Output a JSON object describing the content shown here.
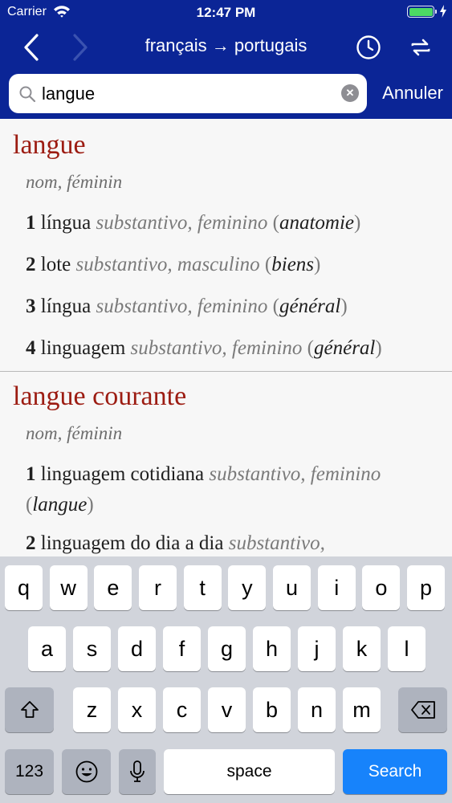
{
  "status": {
    "carrier": "Carrier",
    "time": "12:47 PM"
  },
  "nav": {
    "title": "français → portugais"
  },
  "search": {
    "value": "langue",
    "cancel_label": "Annuler"
  },
  "entries": [
    {
      "headword": "langue",
      "pos": "nom, féminin",
      "senses": [
        {
          "num": "1",
          "term": "língua",
          "gram": "substantivo, feminino",
          "context": "anatomie"
        },
        {
          "num": "2",
          "term": "lote",
          "gram": "substantivo, masculino",
          "context": "biens"
        },
        {
          "num": "3",
          "term": "língua",
          "gram": "substantivo, feminino",
          "context": "général"
        },
        {
          "num": "4",
          "term": "linguagem",
          "gram": "substantivo, feminino",
          "context": "général"
        }
      ]
    },
    {
      "headword": "langue courante",
      "pos": "nom, féminin",
      "senses": [
        {
          "num": "1",
          "term": "linguagem cotidiana",
          "gram": "substantivo, feminino",
          "context": "langue"
        },
        {
          "num": "2",
          "term": "linguagem do dia a dia",
          "gram": "substantivo,"
        }
      ]
    }
  ],
  "keyboard": {
    "row1": [
      "q",
      "w",
      "e",
      "r",
      "t",
      "y",
      "u",
      "i",
      "o",
      "p"
    ],
    "row2": [
      "a",
      "s",
      "d",
      "f",
      "g",
      "h",
      "j",
      "k",
      "l"
    ],
    "row3": [
      "z",
      "x",
      "c",
      "v",
      "b",
      "n",
      "m"
    ],
    "numbers_label": "123",
    "space_label": "space",
    "search_label": "Search"
  },
  "colors": {
    "nav_bg": "#0b2596",
    "headword": "#9c1c12",
    "search_key": "#1783fb",
    "battery": "#4cd964"
  }
}
